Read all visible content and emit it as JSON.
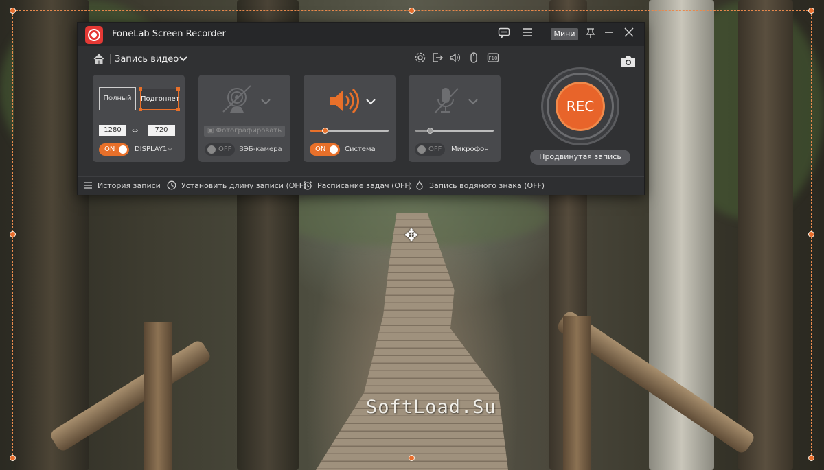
{
  "app": {
    "title": "FoneLab Screen Recorder",
    "mini_label": "Мини",
    "mode_label": "Запись видео"
  },
  "display_panel": {
    "full_label": "Полный",
    "fit_label": "Подгоняет",
    "width": "1280",
    "height": "720",
    "toggle": "ON",
    "display_name": "DISPLAY1"
  },
  "webcam_panel": {
    "snapshot_label": "Фотографировать",
    "toggle": "OFF",
    "label": "ВЭБ-камера"
  },
  "system_panel": {
    "toggle": "ON",
    "label": "Система",
    "volume": 0.18
  },
  "mic_panel": {
    "toggle": "OFF",
    "label": "Микрофон",
    "volume": 0.18
  },
  "rec": {
    "label": "REC",
    "advanced_label": "Продвинутая запись"
  },
  "statusbar": {
    "history": "История записи",
    "length": "Установить длину записи (OFF)",
    "schedule": "Расписание задач (OFF)",
    "watermark": "Запись водяного знака (OFF)"
  },
  "backdrop": {
    "watermark_text": "SoftLoad.Su"
  },
  "colors": {
    "accent": "#e8702a",
    "window_bg": "#303133",
    "panel_bg": "#48494c",
    "title_bg": "#262729"
  }
}
